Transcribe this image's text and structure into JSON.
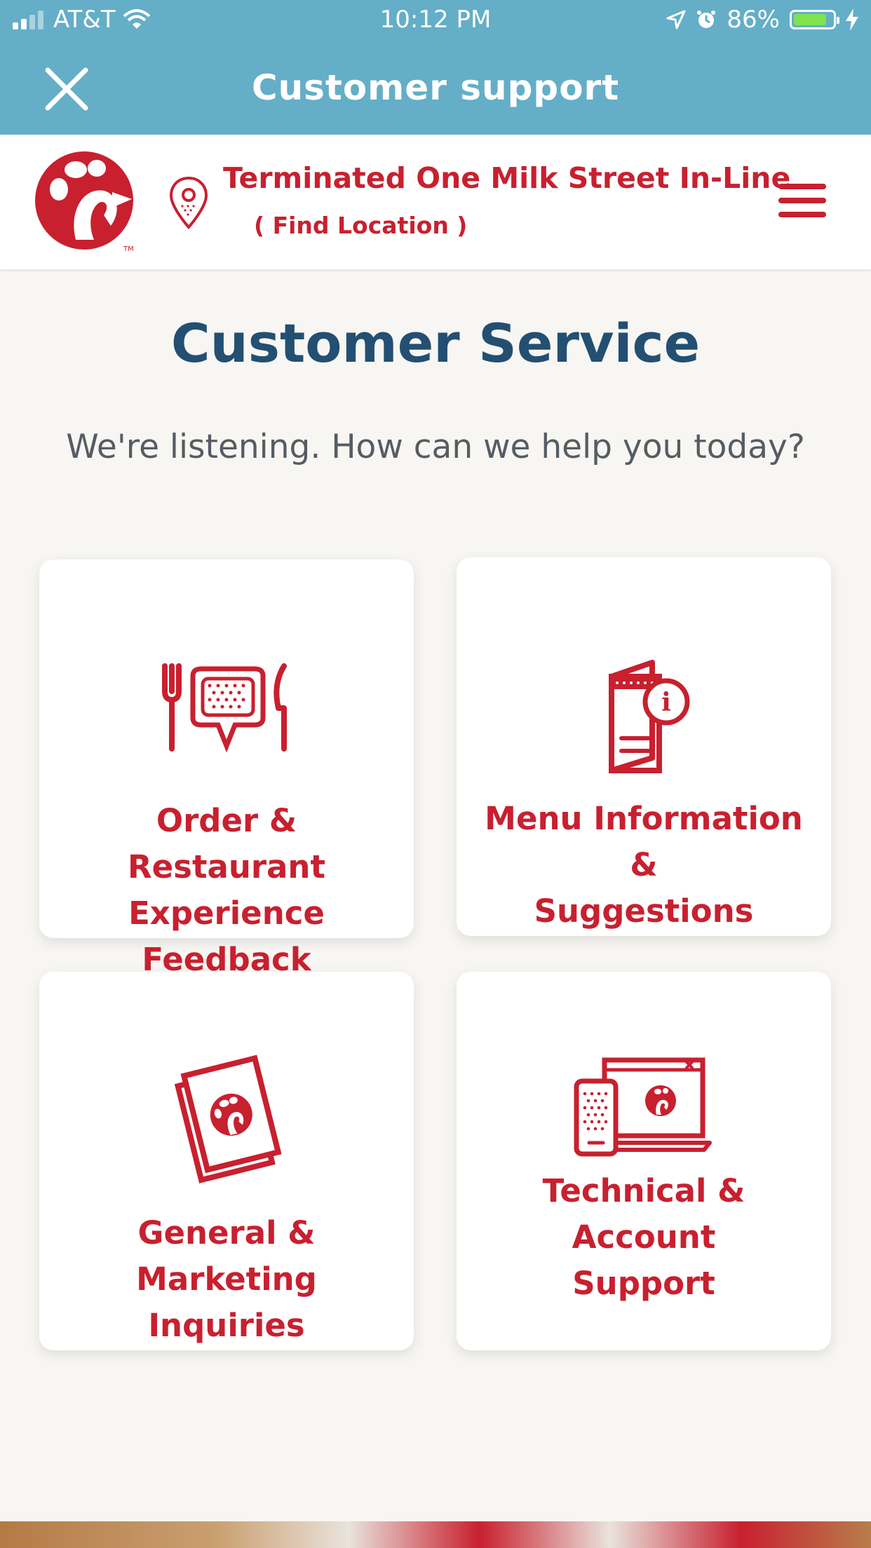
{
  "status_bar": {
    "carrier": "AT&T",
    "time": "10:12 PM",
    "battery": "86%",
    "battery_level": 0.86
  },
  "nav": {
    "title": "Customer support"
  },
  "header": {
    "store_name": "Terminated One Milk Street In-Line",
    "find_location": "( Find Location )"
  },
  "main": {
    "title": "Customer Service",
    "subtitle": "We're listening. How can we help you today?"
  },
  "cards": [
    {
      "line1": "Order & Restaurant",
      "line2": "Experience Feedback",
      "icon": "utensils-speech-icon"
    },
    {
      "line1": "Menu Information &",
      "line2": "Suggestions",
      "icon": "menu-info-icon"
    },
    {
      "line1": "General & Marketing",
      "line2": "Inquiries",
      "icon": "brochure-icon"
    },
    {
      "line1": "Technical & Account",
      "line2": "Support",
      "icon": "devices-icon"
    }
  ],
  "colors": {
    "bar": "#64aec7",
    "brand_red": "#c8202f",
    "title_blue": "#234f72"
  }
}
